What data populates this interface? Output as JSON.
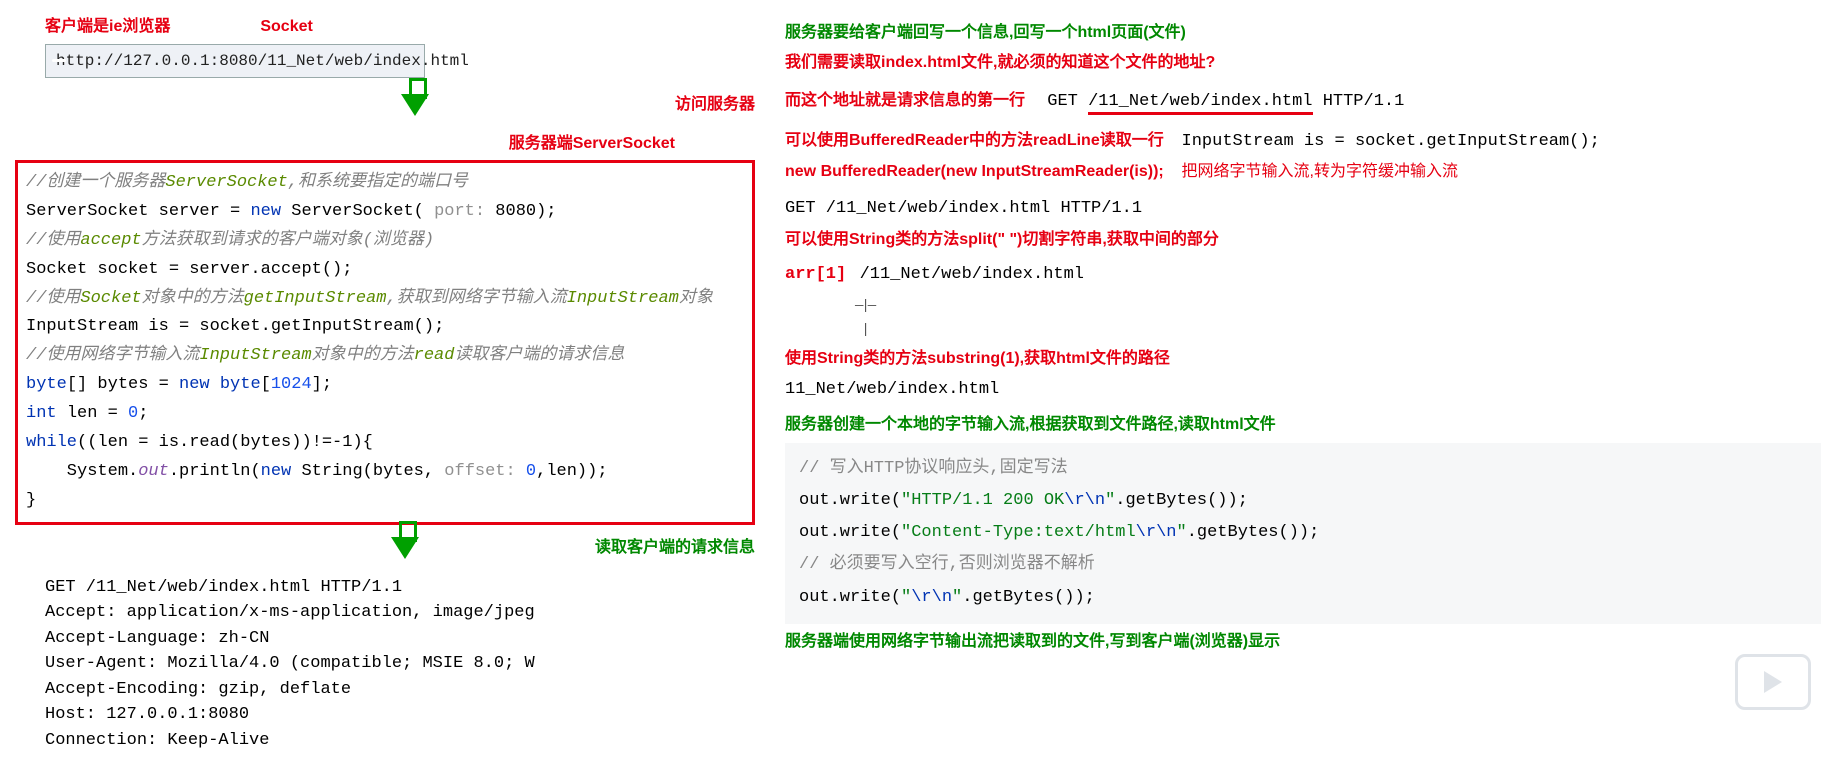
{
  "left": {
    "label_client": "客户端是ie浏览器",
    "label_socket": "Socket",
    "url": "http://127.0.0.1:8080/11_Net/web/index.html",
    "label_access": "访问服务器",
    "label_server": "服务器端ServerSocket",
    "code": {
      "c1a": "//创建一个服务器",
      "c1b": "ServerSocket",
      "c1c": ",和系统要指定的端口号",
      "l2a": "ServerSocket server = ",
      "l2new": "new ",
      "l2b": "ServerSocket( ",
      "l2hint": "port: ",
      "l2c": "8080);",
      "c3a": "//使用",
      "c3b": "accept",
      "c3c": "方法获取到请求的客户端对象(浏览器)",
      "l4": "Socket socket = server.accept();",
      "c5a": "//使用",
      "c5b": "Socket",
      "c5c": "对象中的方法",
      "c5d": "getInputStream",
      "c5e": ",获取到网络字节输入流",
      "c5f": "InputStream",
      "c5g": "对象",
      "l6": "InputStream is = socket.getInputStream();",
      "c7a": "//使用网络字节输入流",
      "c7b": "InputStream",
      "c7c": "对象中的方法",
      "c7d": "read",
      "c7e": "读取客户端的请求信息",
      "l8a": "byte",
      "l8b": "[] bytes = ",
      "l8new": "new ",
      "l8c": "byte",
      "l8d": "[",
      "l8n": "1024",
      "l8e": "];",
      "l9a": "int ",
      "l9b": "len = ",
      "l9n": "0",
      "l9c": ";",
      "l10a": "while",
      "l10b": "((len = is.read(bytes))!=-1){",
      "l11a": "    System.",
      "l11o": "out",
      "l11b": ".println(",
      "l11new": "new ",
      "l11c": "String(bytes, ",
      "l11hint": "offset: ",
      "l11d": "0",
      "l11e": ",len));",
      "l12": "}"
    },
    "label_read": "读取客户端的请求信息",
    "http": {
      "l1": "GET /11_Net/web/index.html HTTP/1.1",
      "l2": "Accept: application/x-ms-application, image/jpeg",
      "l3": "Accept-Language: zh-CN",
      "l4": "User-Agent: Mozilla/4.0 (compatible; MSIE 8.0; W",
      "l5": "Accept-Encoding: gzip, deflate",
      "l6": "Host: 127.0.0.1:8080",
      "l7": "Connection: Keep-Alive"
    }
  },
  "right": {
    "r1": "服务器要给客户端回写一个信息,回写一个html页面(文件)",
    "r2": "我们需要读取index.html文件,就必须的知道这个文件的地址?",
    "r3a": "而这个地址就是请求信息的第一行",
    "r3b": "GET ",
    "r3u": "/11_Net/web/index.html",
    "r3c": " HTTP/1.1",
    "r4a": "可以使用BufferedReader中的方法readLine读取一行",
    "r4b": "InputStream is = socket.getInputStream();",
    "r5a": "new BufferedReader(new InputStreamReader(is));",
    "r5b": "把网络字节输入流,转为字符缓冲输入流",
    "r6": "GET /11_Net/web/index.html HTTP/1.1",
    "r7": "可以使用String类的方法split(\" \")切割字符串,获取中间的部分",
    "r8a": "arr[1]",
    "r8b": "/11_Net/web/index.html",
    "r9": "使用String类的方法substring(1),获取html文件的路径",
    "r10": "11_Net/web/index.html",
    "r11": "服务器创建一个本地的字节输入流,根据获取到文件路径,读取html文件",
    "code2": {
      "c1": "// 写入HTTP协议响应头,固定写法",
      "l2a": "out.write(",
      "l2s": "\"HTTP/1.1 200 OK",
      "l2e": "\\r\\n",
      "l2q": "\"",
      "l2b": ".getBytes());",
      "l3a": "out.write(",
      "l3s": "\"Content-Type:text/html",
      "l3e": "\\r\\n",
      "l3q": "\"",
      "l3b": ".getBytes());",
      "c4": "// 必须要写入空行,否则浏览器不解析",
      "l5a": "out.write(",
      "l5s": "\"",
      "l5e": "\\r\\n",
      "l5q": "\"",
      "l5b": ".getBytes());"
    },
    "r12": "服务器端使用网络字节输出流把读取到的文件,写到客户端(浏览器)显示"
  }
}
